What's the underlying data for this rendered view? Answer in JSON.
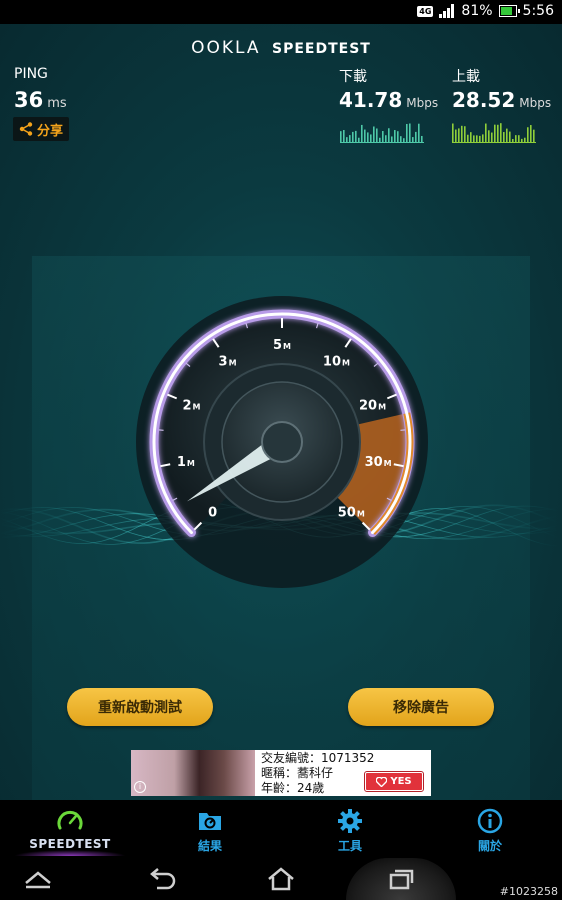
{
  "status_bar": {
    "network": "4G",
    "battery": "81%",
    "battery_level": 0.81,
    "time": "5:56"
  },
  "header": {
    "brand_logo": "OOKLA",
    "brand_product": "SPEEDTEST"
  },
  "ping": {
    "label": "PING",
    "value": "36",
    "unit": "ms"
  },
  "share": {
    "label": "分享",
    "icon": "share-icon"
  },
  "download": {
    "label": "下載",
    "value": "41.78",
    "unit": "Mbps",
    "color": "#4ec9a8"
  },
  "upload": {
    "label": "上載",
    "value": "28.52",
    "unit": "Mbps",
    "color": "#8fcf3a"
  },
  "gauge": {
    "ticks": [
      {
        "value": "0",
        "unit": ""
      },
      {
        "value": "1",
        "unit": "M"
      },
      {
        "value": "2",
        "unit": "M"
      },
      {
        "value": "3",
        "unit": "M"
      },
      {
        "value": "5",
        "unit": "M"
      },
      {
        "value": "10",
        "unit": "M"
      },
      {
        "value": "20",
        "unit": "M"
      },
      {
        "value": "30",
        "unit": "M"
      },
      {
        "value": "50",
        "unit": "M"
      }
    ],
    "arc_color": "#b89ce8",
    "accent_color": "#e08a2d"
  },
  "buttons": {
    "restart": "重新啟動測試",
    "remove_ads": "移除廣告"
  },
  "ad": {
    "line1": "交友編號：1071352",
    "line2": "暱稱：蕎科仔",
    "line3": "年齡：24歲",
    "cta": "YES",
    "info_icon": "i"
  },
  "tabs": [
    {
      "label": "SPEEDTEST",
      "icon": "speedometer-icon"
    },
    {
      "label": "結果",
      "icon": "results-folder-icon"
    },
    {
      "label": "工具",
      "icon": "gear-icon"
    },
    {
      "label": "關於",
      "icon": "info-icon"
    }
  ],
  "watermark": "#1023258"
}
